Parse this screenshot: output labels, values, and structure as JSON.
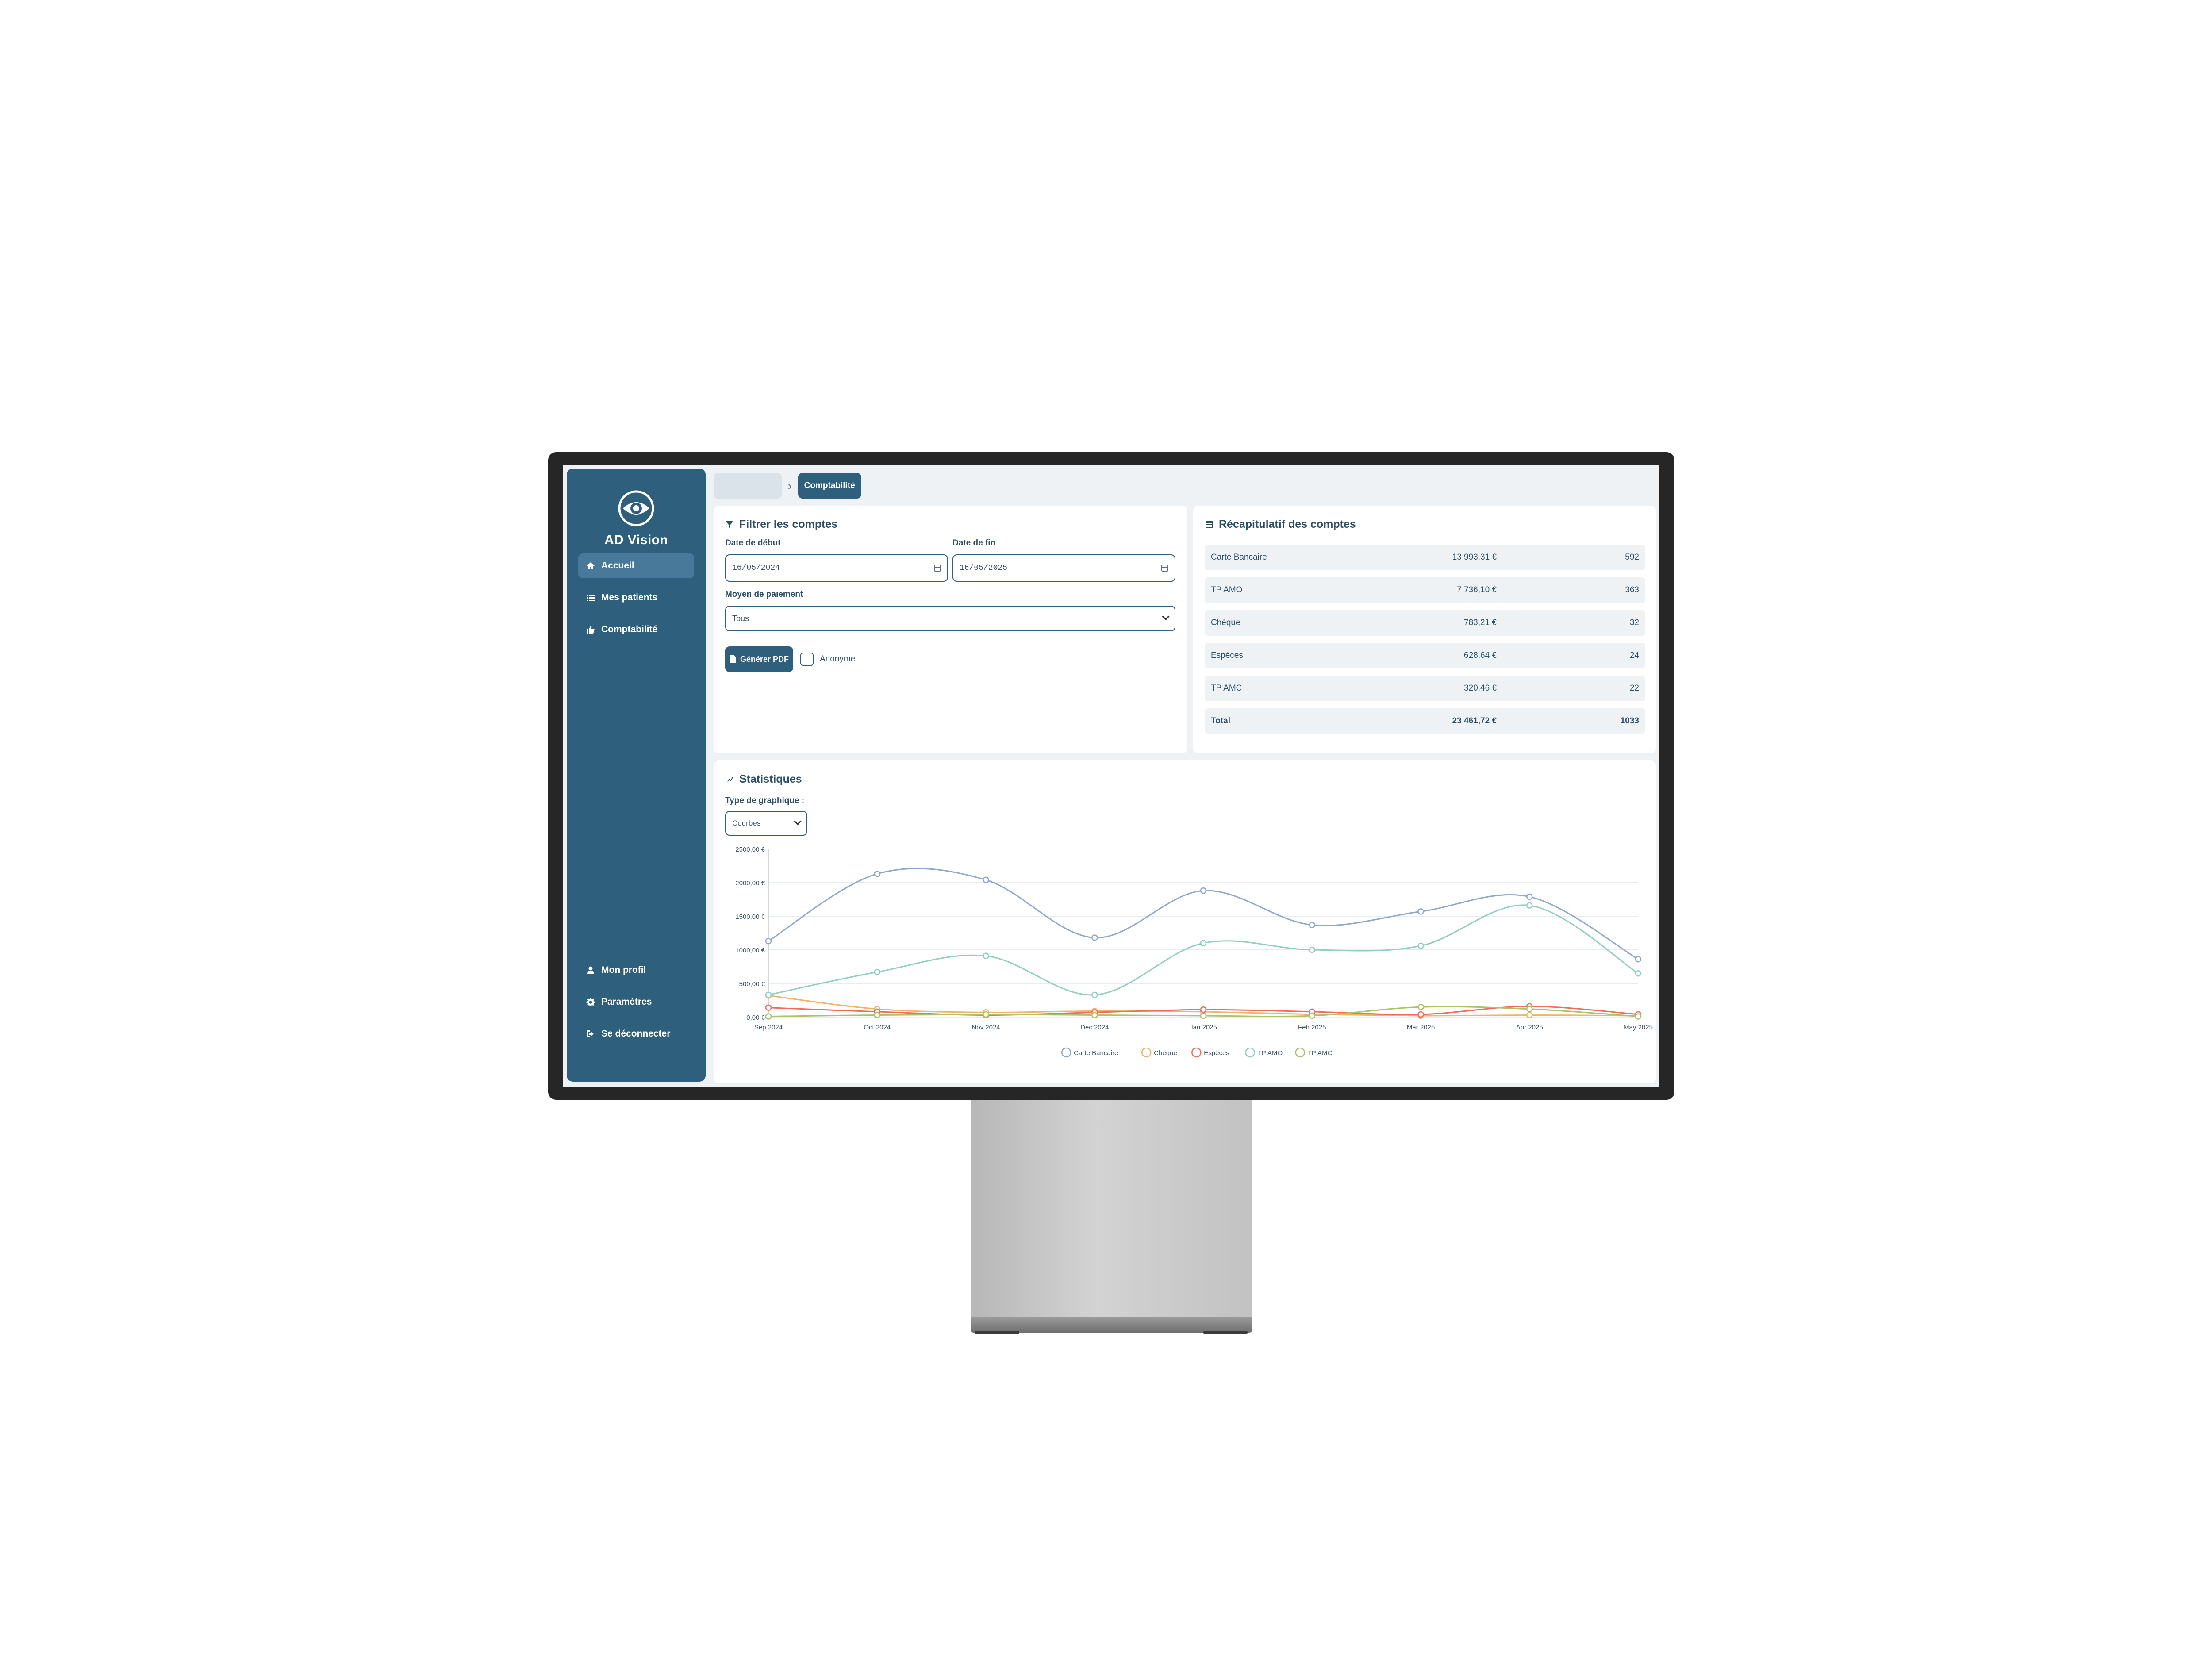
{
  "app": {
    "name": "AD Vision"
  },
  "sidebar": {
    "items": [
      {
        "label": "Accueil",
        "icon": "home-icon",
        "active": true
      },
      {
        "label": "Mes patients",
        "icon": "list-icon",
        "active": false
      },
      {
        "label": "Comptabilité",
        "icon": "thumbs-up-icon",
        "active": false
      }
    ],
    "bottom_items": [
      {
        "label": "Mon profil",
        "icon": "user-icon"
      },
      {
        "label": "Paramètres",
        "icon": "gear-icon"
      },
      {
        "label": "Se déconnecter",
        "icon": "logout-icon"
      }
    ]
  },
  "breadcrumb": {
    "current": "Comptabilité"
  },
  "filter": {
    "title": "Filtrer les comptes",
    "start_label": "Date de début",
    "start_value": "16/05/2024",
    "end_label": "Date de fin",
    "end_value": "16/05/2025",
    "payment_label": "Moyen de paiement",
    "payment_value": "Tous",
    "pdf_button": "Générer PDF",
    "anonymous_label": "Anonyme"
  },
  "summary": {
    "title": "Récapitulatif des comptes",
    "rows": [
      {
        "name": "Carte Bancaire",
        "amount": "13 993,31 €",
        "count": "592"
      },
      {
        "name": "TP AMO",
        "amount": "7 736,10 €",
        "count": "363"
      },
      {
        "name": "Chèque",
        "amount": "783,21 €",
        "count": "32"
      },
      {
        "name": "Espèces",
        "amount": "628,64 €",
        "count": "24"
      },
      {
        "name": "TP AMC",
        "amount": "320,46 €",
        "count": "22"
      }
    ],
    "total": {
      "name": "Total",
      "amount": "23 461,72 €",
      "count": "1033"
    }
  },
  "stats": {
    "title": "Statistiques",
    "chart_type_label": "Type de graphique :",
    "chart_type_value": "Courbes"
  },
  "chart_data": {
    "type": "line",
    "categories": [
      "Sep 2024",
      "Oct 2024",
      "Nov 2024",
      "Dec 2024",
      "Jan 2025",
      "Feb 2025",
      "Mar 2025",
      "Apr 2025",
      "May 2025"
    ],
    "y_ticks": [
      "0,00 €",
      "500,00 €",
      "1000,00 €",
      "1500,00 €",
      "2000,00 €",
      "2500,00 €"
    ],
    "ylim": [
      0,
      2500
    ],
    "grid": true,
    "legend_position": "bottom",
    "series": [
      {
        "name": "Carte Bancaire",
        "color": "#8fa8c9",
        "values": [
          1130,
          2130,
          2040,
          1180,
          1880,
          1370,
          1570,
          1790,
          860
        ]
      },
      {
        "name": "Chèque",
        "color": "#f2b26b",
        "values": [
          320,
          120,
          70,
          90,
          80,
          40,
          20,
          30,
          20
        ]
      },
      {
        "name": "Espèces",
        "color": "#f06d5c",
        "values": [
          140,
          80,
          30,
          70,
          110,
          80,
          40,
          160,
          40
        ]
      },
      {
        "name": "TP AMO",
        "color": "#8fcfbf",
        "values": [
          330,
          670,
          910,
          330,
          1100,
          1000,
          1060,
          1660,
          650
        ]
      },
      {
        "name": "TP AMC",
        "color": "#a8c36a",
        "values": [
          10,
          30,
          40,
          30,
          20,
          20,
          150,
          120,
          10
        ]
      }
    ]
  }
}
